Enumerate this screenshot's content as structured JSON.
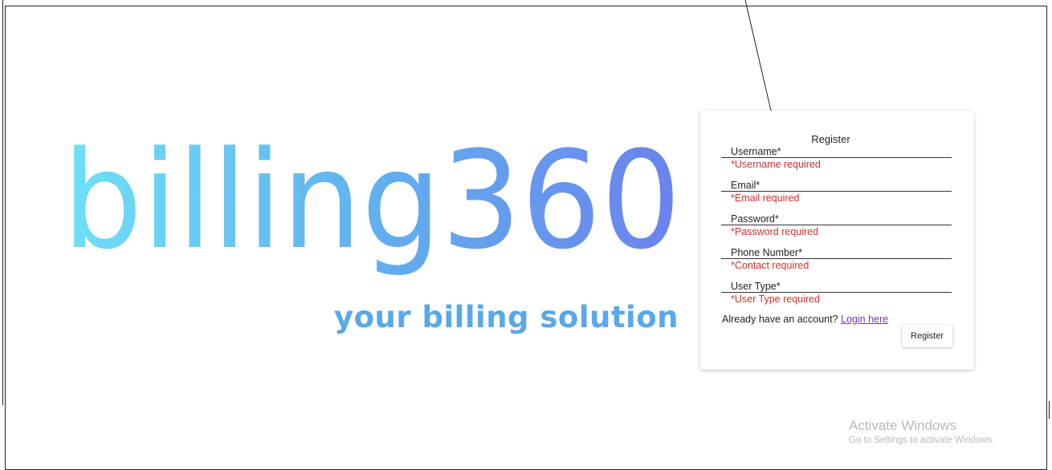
{
  "brand": {
    "logo_text": "billing360",
    "tagline": "your billing solution"
  },
  "form": {
    "title": "Register",
    "fields": [
      {
        "label": "Username*",
        "error": "*Username required"
      },
      {
        "label": "Email*",
        "error": "*Email required"
      },
      {
        "label": "Password*",
        "error": "*Password required"
      },
      {
        "label": "Phone Number*",
        "error": "*Contact required"
      },
      {
        "label": "User Type*",
        "error": "*User Type required"
      }
    ],
    "login_prompt": "Already have an account?",
    "login_link": "Login here",
    "submit_label": "Register"
  },
  "watermark": {
    "title": "Activate Windows",
    "subtitle": "Go to Settings to activate Windows."
  },
  "colors": {
    "logo_gradient_start": "#6ee0f8",
    "logo_gradient_end": "#6a82ec",
    "tagline": "#59a8e8",
    "error": "#d32f2f",
    "link": "#6a3ab0"
  }
}
